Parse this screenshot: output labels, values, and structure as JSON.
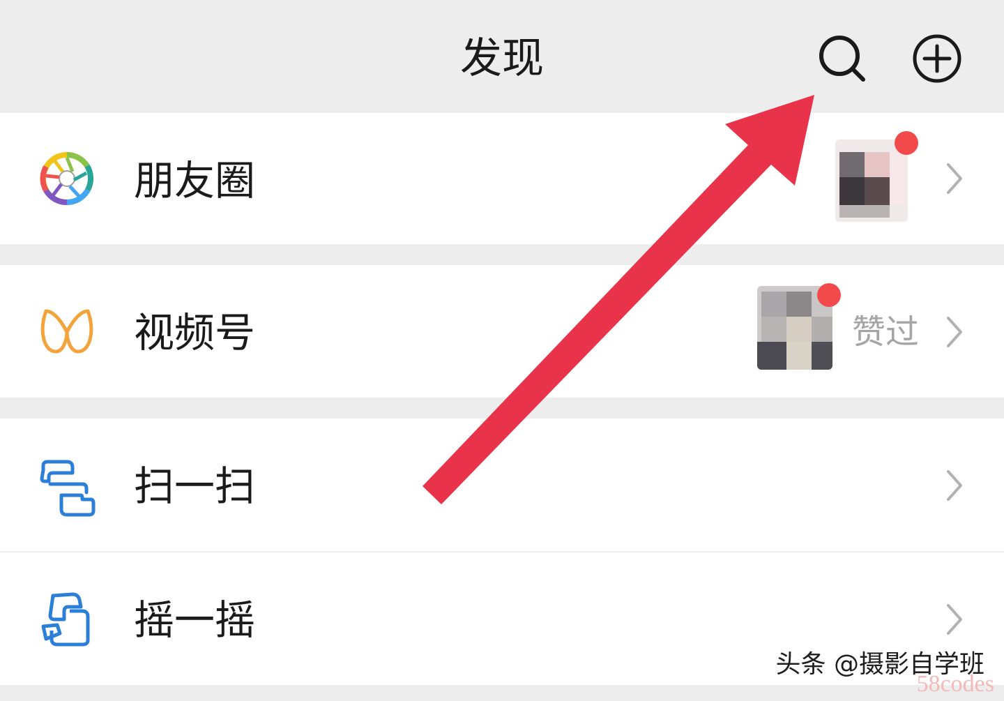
{
  "header": {
    "title": "发现"
  },
  "rows": [
    {
      "label": "朋友圈",
      "icon": "moments-aperture-icon",
      "has_thumb": true,
      "has_badge": true
    },
    {
      "label": "视频号",
      "icon": "channels-icon",
      "has_thumb": true,
      "has_badge": true,
      "extra_text": "赞过"
    },
    {
      "label": "扫一扫",
      "icon": "scan-icon"
    },
    {
      "label": "摇一摇",
      "icon": "shake-icon"
    }
  ],
  "colors": {
    "background": "#ededed",
    "row_bg": "#ffffff",
    "badge": "#f24a4a",
    "arrow": "#e8334a",
    "scan_blue": "#2b7fd8",
    "channels_orange": "#f2a33a"
  },
  "watermark": {
    "text": "头条 @摄影自学班",
    "sub": "58codes"
  }
}
